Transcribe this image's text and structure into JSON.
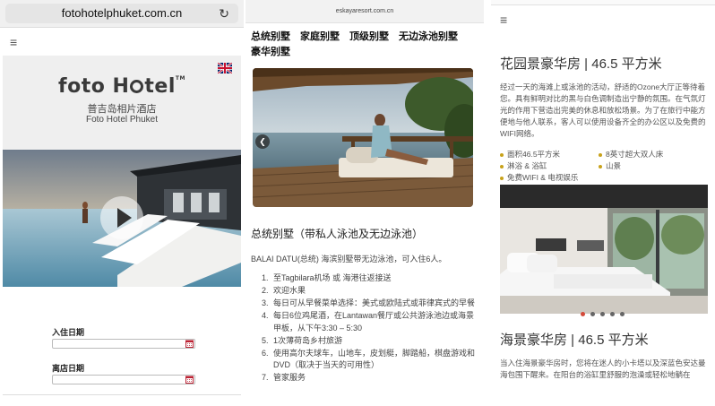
{
  "panel1": {
    "url": "fotohotelphuket.com.cn",
    "logo_text": "foto H",
    "logo_text_end": "tel",
    "logo_tm": "TM",
    "hotel_name_cn": "普吉岛相片酒店",
    "hotel_name_en": "Foto Hotel Phuket",
    "checkin_label": "入住日期",
    "checkout_label": "离店日期",
    "checkin_value": "",
    "checkout_value": ""
  },
  "panel2": {
    "domain": "eskayaresort.com.cn",
    "tabs": [
      "总统别墅",
      "家庭别墅",
      "顶级别墅",
      "无边泳池别墅",
      "豪华别墅"
    ],
    "villa_title": "总统别墅（带私人泳池及无边泳池）",
    "villa_intro": "BALAI DATU(总统) 海滨别墅带无边泳池，可入住6人。",
    "amenities": [
      "至Tagbilara机场 或 海港往返接送",
      "欢迎水果",
      "每日可从早餐菜单选择：美式或欧陆式或菲律宾式的早餐",
      "每日6位鸡尾酒，在Lantawan餐厅或公共游泳池边或海景甲板，从下午3:30 – 5:30",
      "1次薄荷岛乡村旅游",
      "使用高尔夫球车，山地车，皮划艇，脚踏船，棋盘游戏和DVD（取决于当天的可用性）",
      "管家服务"
    ]
  },
  "panel3": {
    "room1_title": "花园景豪华房 | 46.5 平方米",
    "room1_desc": "经过一天的海滩上或泳池的活动，舒适的Ozone大厅正等待着您。具有鲜明对比的黑与白色调制造出宁静的氛围。在气氛灯光的作用下营造出完美的休息和放松场景。为了在旅行中能方便地与他人联系，客人可以使用设备齐全的办公区以及免费的WIFI网络。",
    "features": [
      "面积46.5平方米",
      "8英寸超大双人床",
      "淋浴 & 浴缸",
      "山景",
      "免费WIFI & 电视娱乐"
    ],
    "room2_title": "海景豪华房 | 46.5 平方米",
    "room2_desc": "当入住海景豪华房时，您将在迷人的小卡塔以及深蓝色安达曼海包围下醒来。在阳台的浴缸里舒服的泡澡或轻松地躺在",
    "accent_color": "#c8a21a"
  },
  "slider_dot_count": 5,
  "slider_active_index": 0
}
